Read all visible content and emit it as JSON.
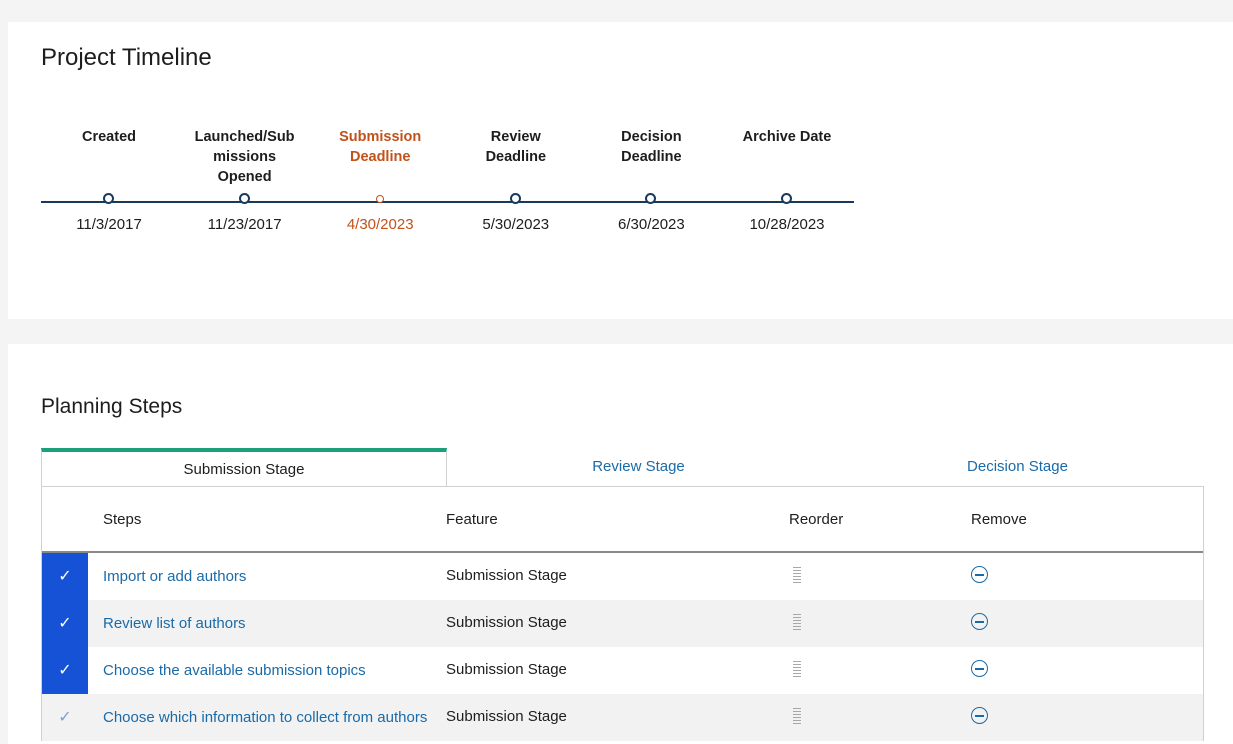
{
  "timeline": {
    "title": "Project Timeline",
    "milestones": [
      {
        "label_lines": [
          "Created"
        ],
        "date": "11/3/2017",
        "current": false
      },
      {
        "label_lines": [
          "Launched/Sub",
          "missions",
          "Opened"
        ],
        "date": "11/23/2017",
        "current": false
      },
      {
        "label_lines": [
          "Submission",
          "Deadline"
        ],
        "date": "4/30/2023",
        "current": true
      },
      {
        "label_lines": [
          "Review",
          "Deadline"
        ],
        "date": "5/30/2023",
        "current": false
      },
      {
        "label_lines": [
          "Decision",
          "Deadline"
        ],
        "date": "6/30/2023",
        "current": false
      },
      {
        "label_lines": [
          "Archive Date"
        ],
        "date": "10/28/2023",
        "current": false
      }
    ]
  },
  "planning": {
    "title": "Planning Steps",
    "tabs": [
      "Submission Stage",
      "Review Stage",
      "Decision Stage"
    ],
    "active_tab": 0,
    "columns": {
      "steps": "Steps",
      "feature": "Feature",
      "reorder": "Reorder",
      "remove": "Remove"
    },
    "rows": [
      {
        "step": "Import or add authors",
        "feature": "Submission Stage",
        "done": true
      },
      {
        "step": "Review list of authors",
        "feature": "Submission Stage",
        "done": true
      },
      {
        "step": "Choose the available submission topics",
        "feature": "Submission Stage",
        "done": true
      },
      {
        "step": "Choose which information to collect from authors",
        "feature": "Submission Stage",
        "done": false
      }
    ]
  },
  "icons": {
    "check": "✓",
    "reorder": "drag-handle-icon",
    "remove": "remove-circle-icon"
  },
  "colors": {
    "accent_blue": "#1652d6",
    "link_blue": "#1a6aa8",
    "current_orange": "#c2521a",
    "tab_active_green": "#1aa07a",
    "timeline_navy": "#1a3a5c"
  }
}
